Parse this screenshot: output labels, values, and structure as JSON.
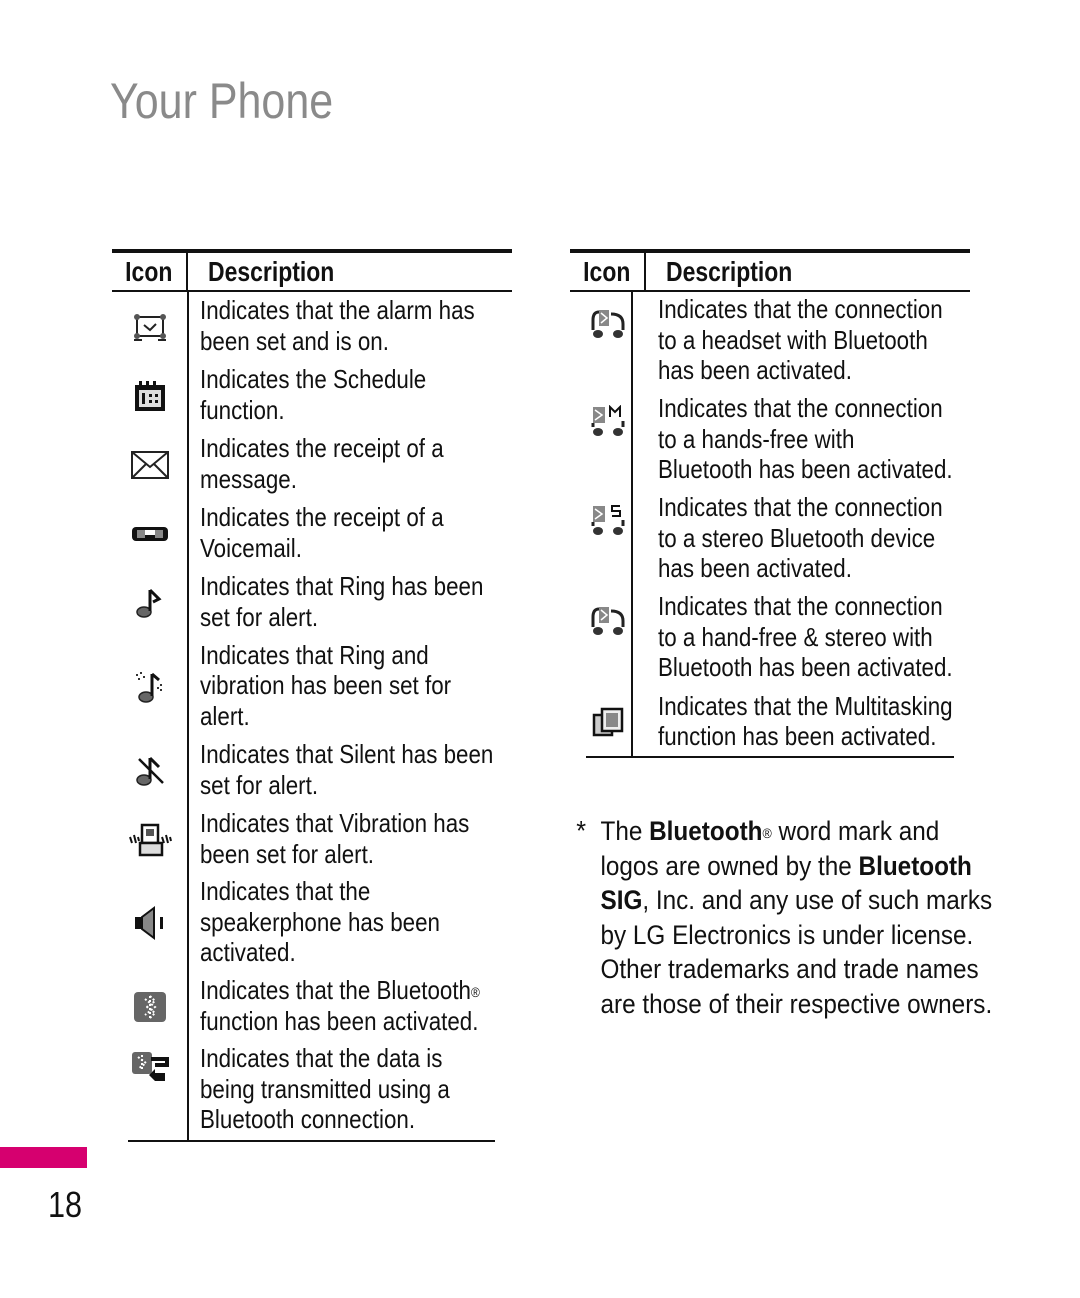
{
  "page": {
    "title": "Your Phone",
    "page_number": "18",
    "accent_color": "#d6006f"
  },
  "left_table": {
    "header": {
      "icon": "Icon",
      "description": "Description"
    },
    "rows": [
      {
        "icon": "alarm-clock-icon",
        "description": "Indicates that the alarm has been set and is on."
      },
      {
        "icon": "schedule-calendar-icon",
        "description": "Indicates the Schedule function."
      },
      {
        "icon": "message-envelope-icon",
        "description": "Indicates the receipt of a message."
      },
      {
        "icon": "voicemail-icon",
        "description": "Indicates the receipt of a Voicemail."
      },
      {
        "icon": "ring-note-icon",
        "description": "Indicates that Ring has been set for alert."
      },
      {
        "icon": "ring-vibration-icon",
        "description": "Indicates that Ring and vibration has been set for alert."
      },
      {
        "icon": "silent-note-icon",
        "description": "Indicates that Silent has been set for alert."
      },
      {
        "icon": "vibration-icon",
        "description": "Indicates that Vibration has been set for alert."
      },
      {
        "icon": "speakerphone-icon",
        "description": "Indicates that the speakerphone has been activated."
      },
      {
        "icon": "bluetooth-icon",
        "description_before": "Indicates that the Bluetooth",
        "description_reg": "®",
        "description_after": " function has been activated."
      },
      {
        "icon": "bluetooth-data-transfer-icon",
        "description": "Indicates that the data is being transmitted using a Bluetooth connection."
      }
    ]
  },
  "right_table": {
    "header": {
      "icon": "Icon",
      "description": "Description"
    },
    "rows": [
      {
        "icon": "bluetooth-headset-icon",
        "description": "Indicates that the connection to a headset with Bluetooth has been activated."
      },
      {
        "icon": "bluetooth-handsfree-icon",
        "description": "Indicates that the connection to a hands-free with Bluetooth has been activated."
      },
      {
        "icon": "bluetooth-stereo-icon",
        "description": "Indicates that the connection to a stereo Bluetooth device has been activated."
      },
      {
        "icon": "bluetooth-handsfree-stereo-icon",
        "description": "Indicates that the connection to a hand-free & stereo with Bluetooth has been activated."
      },
      {
        "icon": "multitasking-icon",
        "description": "Indicates that the Multitasking function has been activated."
      }
    ]
  },
  "note": {
    "asterisk": "*",
    "part1": "The ",
    "bold1": "Bluetooth",
    "reg": "®",
    "part2": " word mark and logos are owned by the ",
    "bold2": "Bluetooth SIG",
    "part3": ", Inc. and any use of such marks by LG Electronics is under license. Other trademarks and trade names are those of their respective owners."
  }
}
